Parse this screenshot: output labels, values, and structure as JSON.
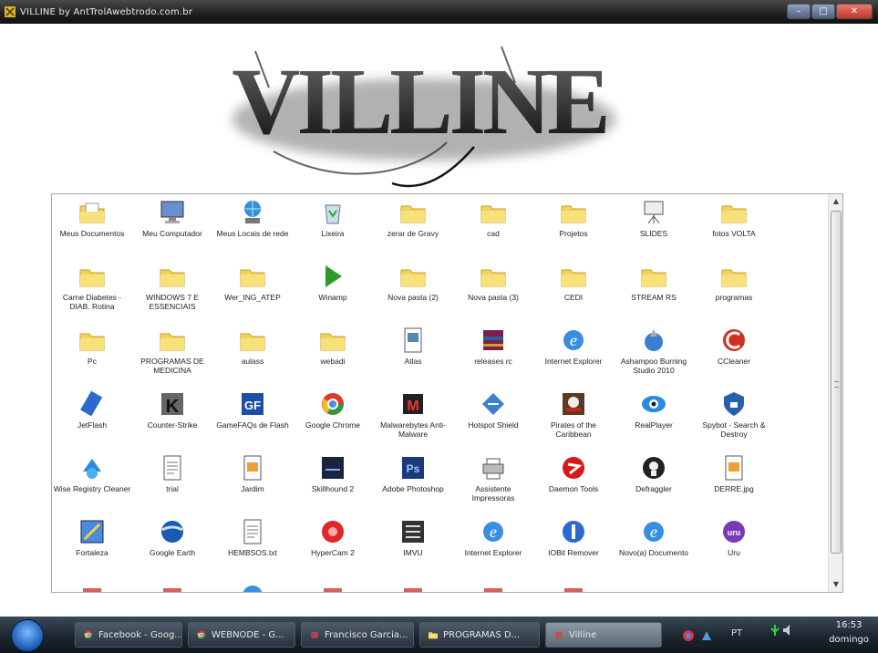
{
  "window": {
    "title": "VILLINE by AntTrolAwebtrodo.com.br"
  },
  "banner": {
    "text": "VILLINE"
  },
  "items": [
    {
      "label": "Meus Documentos",
      "icon": "folder-docs-icon"
    },
    {
      "label": "Meu Computador",
      "icon": "computer-icon"
    },
    {
      "label": "Meus Locais de rede",
      "icon": "network-icon"
    },
    {
      "label": "Lixeira",
      "icon": "recycle-bin-icon"
    },
    {
      "label": "zerar de Gravy",
      "icon": "folder-icon"
    },
    {
      "label": "cad",
      "icon": "folder-icon"
    },
    {
      "label": "Projetos",
      "icon": "folder-icon"
    },
    {
      "label": "SLIDES",
      "icon": "projector-icon"
    },
    {
      "label": "fotos VOLTA",
      "icon": "folder-icon"
    },
    {
      "label": "Carne Diabetes - DIAB. Rotina",
      "icon": "folder-icon"
    },
    {
      "label": "WINDOWS 7 E ESSENCIAIS",
      "icon": "folder-icon"
    },
    {
      "label": "Wer_ING_ATEP",
      "icon": "folder-icon"
    },
    {
      "label": "Winamp",
      "icon": "play-icon"
    },
    {
      "label": "Nova pasta (2)",
      "icon": "folder-icon"
    },
    {
      "label": "Nova pasta (3)",
      "icon": "folder-icon"
    },
    {
      "label": "CEDI",
      "icon": "folder-icon"
    },
    {
      "label": "STREAM RS",
      "icon": "folder-icon"
    },
    {
      "label": "programas",
      "icon": "folder-icon"
    },
    {
      "label": "Pc",
      "icon": "folder-icon"
    },
    {
      "label": "PROGRAMAS DE MEDICINA",
      "icon": "folder-icon"
    },
    {
      "label": "aulass",
      "icon": "folder-icon"
    },
    {
      "label": "webadi",
      "icon": "folder-icon"
    },
    {
      "label": "Atlas",
      "icon": "document-icon"
    },
    {
      "label": "releases rc",
      "icon": "winrar-icon"
    },
    {
      "label": "Internet Explorer",
      "icon": "ie-icon"
    },
    {
      "label": "Ashampoo Burning Studio 2010",
      "icon": "ashampoo-icon"
    },
    {
      "label": "CCleaner",
      "icon": "ccleaner-icon"
    },
    {
      "label": "JetFlash",
      "icon": "jetflash-icon"
    },
    {
      "label": "Counter-Strike",
      "icon": "counter-strike-icon"
    },
    {
      "label": "GameFAQs de Flash",
      "icon": "gf-icon"
    },
    {
      "label": "Google Chrome",
      "icon": "chrome-icon"
    },
    {
      "label": "Malwarebytes Anti-Malware",
      "icon": "malwarebytes-icon"
    },
    {
      "label": "Hotspot Shield",
      "icon": "hotspot-icon"
    },
    {
      "label": "Pirates of the Caribbean",
      "icon": "pirate-icon"
    },
    {
      "label": "RealPlayer",
      "icon": "realplayer-icon"
    },
    {
      "label": "Spybot - Search & Destroy",
      "icon": "spybot-icon"
    },
    {
      "label": "Wise Registry Cleaner",
      "icon": "wise-registry-icon"
    },
    {
      "label": "trial",
      "icon": "text-file-icon"
    },
    {
      "label": "Jardim",
      "icon": "image-file-icon"
    },
    {
      "label": "Skillhound 2",
      "icon": "game-icon"
    },
    {
      "label": "Adobe Photoshop",
      "icon": "photoshop-icon"
    },
    {
      "label": "Assistente Impressoras",
      "icon": "printer-icon"
    },
    {
      "label": "Daemon Tools",
      "icon": "daemon-tools-icon"
    },
    {
      "label": "Defraggler",
      "icon": "defrag-icon"
    },
    {
      "label": "DERRE.jpg",
      "icon": "image-file-icon"
    },
    {
      "label": "Fortaleza",
      "icon": "paint-icon"
    },
    {
      "label": "Google Earth",
      "icon": "google-earth-icon"
    },
    {
      "label": "HEMBSOS.txt",
      "icon": "text-file-icon"
    },
    {
      "label": "HyperCam 2",
      "icon": "hypercam-icon"
    },
    {
      "label": "IMVU",
      "icon": "imvu-icon"
    },
    {
      "label": "Internet Explorer",
      "icon": "ie-icon"
    },
    {
      "label": "IOBit Remover",
      "icon": "iobit-icon"
    },
    {
      "label": "Novo(a) Documento",
      "icon": "ie-icon"
    },
    {
      "label": "Uru",
      "icon": "uru-icon"
    },
    {
      "label": "",
      "icon": "app-icon"
    },
    {
      "label": "",
      "icon": "app-icon"
    },
    {
      "label": "",
      "icon": "ie-icon"
    },
    {
      "label": "",
      "icon": "app-icon"
    },
    {
      "label": "",
      "icon": "app-icon"
    },
    {
      "label": "",
      "icon": "app-icon"
    },
    {
      "label": "",
      "icon": "app-icon"
    }
  ],
  "taskbar": {
    "buttons": [
      {
        "label": "Facebook - Goog...",
        "icon": "chrome-icon",
        "active": false
      },
      {
        "label": "WEBNODE - G...",
        "icon": "chrome-icon",
        "active": false
      },
      {
        "label": "Francisco Garcia...",
        "icon": "app-icon",
        "active": false
      },
      {
        "label": "PROGRAMAS D...",
        "icon": "folder-icon",
        "active": false
      },
      {
        "label": "Villine",
        "icon": "app-icon",
        "active": true
      }
    ],
    "language": "PT",
    "clock_time": "16:53",
    "clock_day": "domingo"
  },
  "colors": {
    "folder": "#f3d25a",
    "accent": "#2a6cc4"
  }
}
